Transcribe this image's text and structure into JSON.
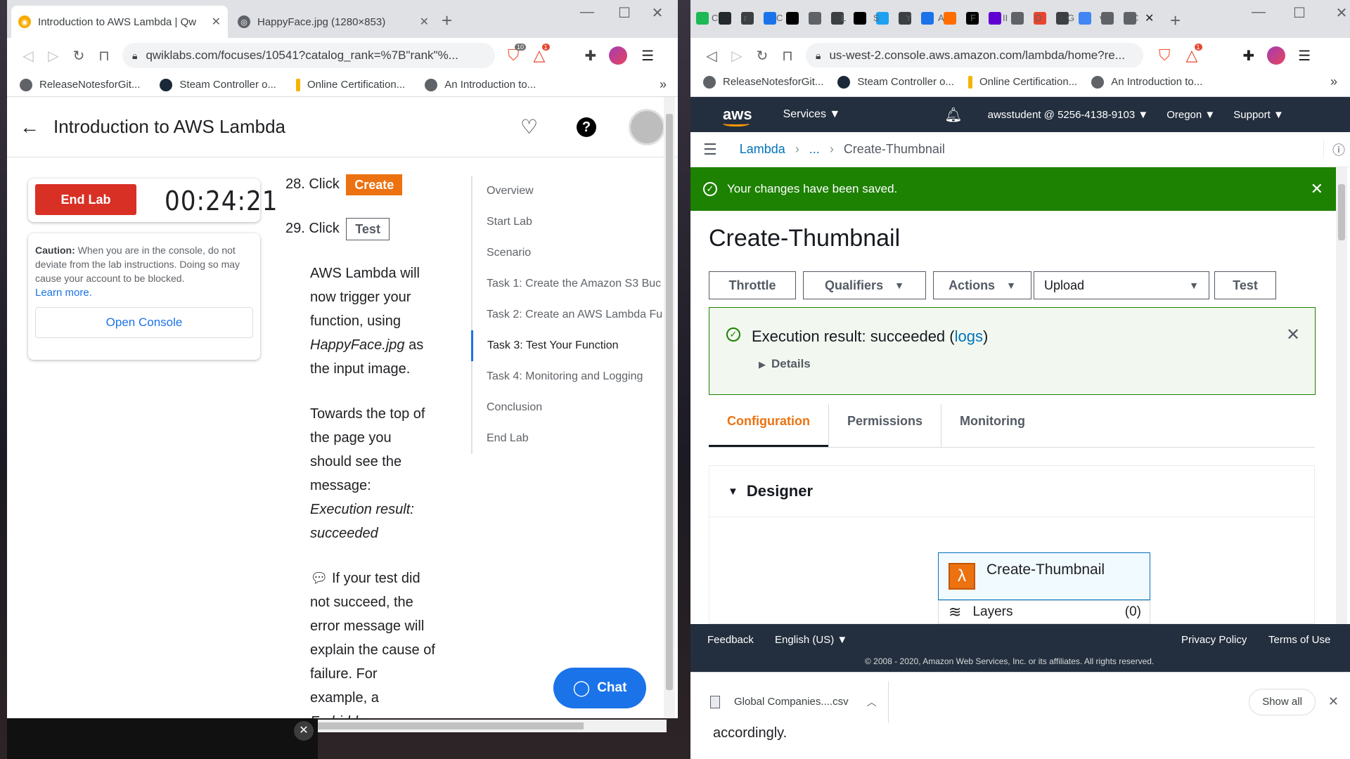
{
  "left_window": {
    "tabs": [
      {
        "title": "Introduction to AWS Lambda | Qw"
      },
      {
        "title": "HappyFace.jpg (1280×853)"
      }
    ],
    "url": "qwiklabs.com/focuses/10541?catalog_rank=%7B\"rank\"%...",
    "ext_badges": {
      "brave": "10",
      "alert": "1"
    },
    "bookmarks": [
      "ReleaseNotesforGit...",
      "Steam Controller o...",
      "Online Certification...",
      "An Introduction to..."
    ],
    "page_title": "Introduction to AWS Lambda",
    "end_lab_label": "End Lab",
    "timer": "00:24:21",
    "caution_label": "Caution:",
    "caution_text": "When you are in the console, do not deviate from the lab instructions. Doing so may cause your account to be blocked.",
    "learn_more": "Learn more.",
    "open_console": "Open Console",
    "step28": "28. Click",
    "step28_btn": "Create",
    "step29": "29. Click",
    "step29_btn": "Test",
    "para1_a": "AWS Lambda will now trigger your function, using",
    "para1_em": "HappyFace.jpg",
    "para1_b": "as the input image.",
    "para2": "Towards the top of the page you should see the message:",
    "para2_em": "Execution result: succeeded",
    "para3": "If your test did not succeed, the error message will explain the cause of failure. For example, a",
    "para3_cut": "Forbidden",
    "toc": [
      "Overview",
      "Start Lab",
      "Scenario",
      "Task 1: Create the Amazon S3 Buc",
      "Task 2: Create an AWS Lambda Fu",
      "Task 3: Test Your Function",
      "Task 4: Monitoring and Logging",
      "Conclusion",
      "End Lab"
    ],
    "toc_current": 5,
    "chat_label": "Chat"
  },
  "right_window": {
    "tab_letters": [
      "C",
      "r",
      "C",
      "P",
      "L",
      "S",
      "Y",
      "A",
      "F",
      "II",
      "D",
      "G",
      "v",
      "C"
    ],
    "url": "us-west-2.console.aws.amazon.com/lambda/home?re...",
    "ext_badges": {
      "alert": "1"
    },
    "bookmarks": [
      "ReleaseNotesforGit...",
      "Steam Controller o...",
      "Online Certification...",
      "An Introduction to..."
    ],
    "nav": {
      "logo": "aws",
      "services": "Services",
      "account": "awsstudent @ 5256-4138-9103",
      "region": "Oregon",
      "support": "Support"
    },
    "breadcrumb": [
      "Lambda",
      "...",
      "Create-Thumbnail"
    ],
    "flash": "Your changes have been saved.",
    "function_name": "Create-Thumbnail",
    "buttons": [
      "Throttle",
      "Qualifiers",
      "Actions",
      "Upload",
      "Test"
    ],
    "exec_result": "Execution result: succeeded (",
    "exec_logs": "logs",
    "exec_close_paren": ")",
    "details": "Details",
    "tabs": [
      "Configuration",
      "Permissions",
      "Monitoring"
    ],
    "designer": "Designer",
    "fn_box": "Create-Thumbnail",
    "layers": "Layers",
    "layers_count": "(0)",
    "footer": {
      "feedback": "Feedback",
      "language": "English (US)",
      "privacy": "Privacy Policy",
      "terms": "Terms of Use",
      "copyright": "© 2008 - 2020, Amazon Web Services, Inc. or its affiliates. All rights reserved."
    },
    "download": {
      "file": "Global Companies....csv",
      "show_all": "Show all"
    },
    "behind_text": "accordingly."
  },
  "colors": {
    "aws_nav": "#232f3e",
    "aws_orange": "#ec7211",
    "success_green": "#1d8102",
    "qwiklabs_red": "#d93025",
    "chat_blue": "#1a73e8"
  }
}
